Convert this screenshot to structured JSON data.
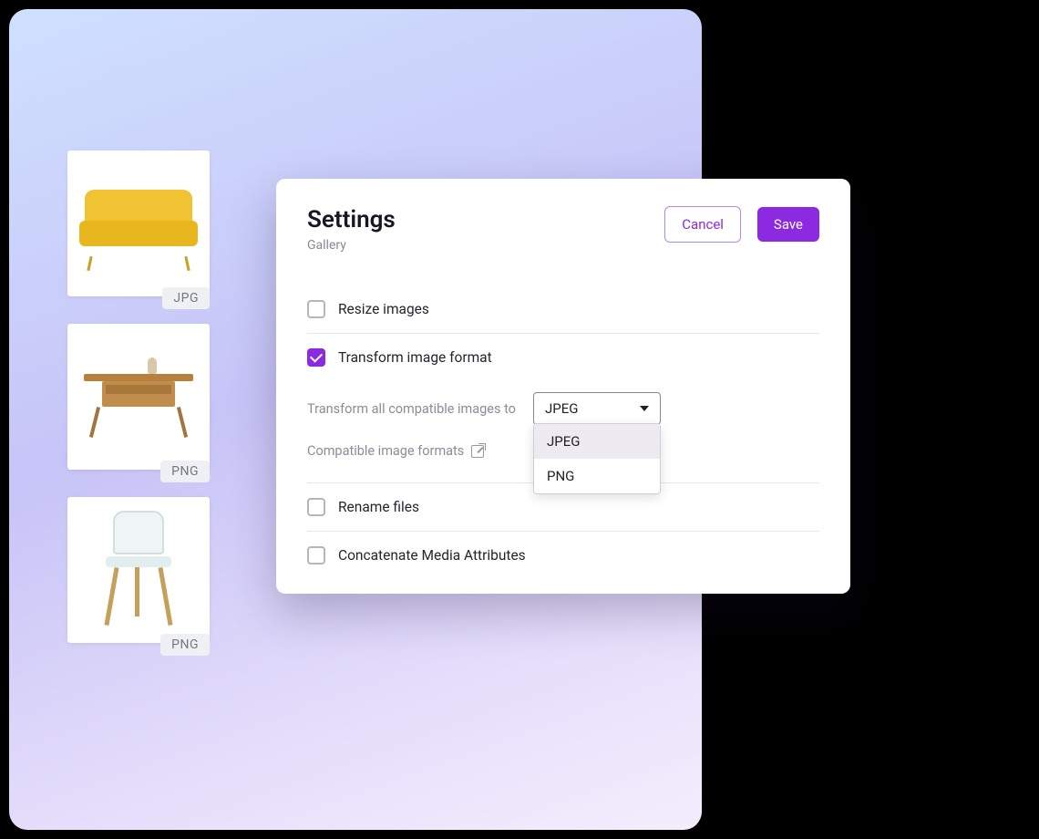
{
  "thumbs": [
    {
      "badge": "JPG"
    },
    {
      "badge": "PNG"
    },
    {
      "badge": "PNG"
    }
  ],
  "panel": {
    "title": "Settings",
    "subtitle": "Gallery",
    "cancel": "Cancel",
    "save": "Save",
    "options": {
      "resize": "Resize images",
      "transform": "Transform image format",
      "transform_to_label": "Transform all compatible images to",
      "compatible_label": "Compatible image formats",
      "rename": "Rename files",
      "concat": "Concatenate Media Attributes"
    },
    "format_select": {
      "selected": "JPEG",
      "options": [
        "JPEG",
        "PNG"
      ]
    }
  }
}
